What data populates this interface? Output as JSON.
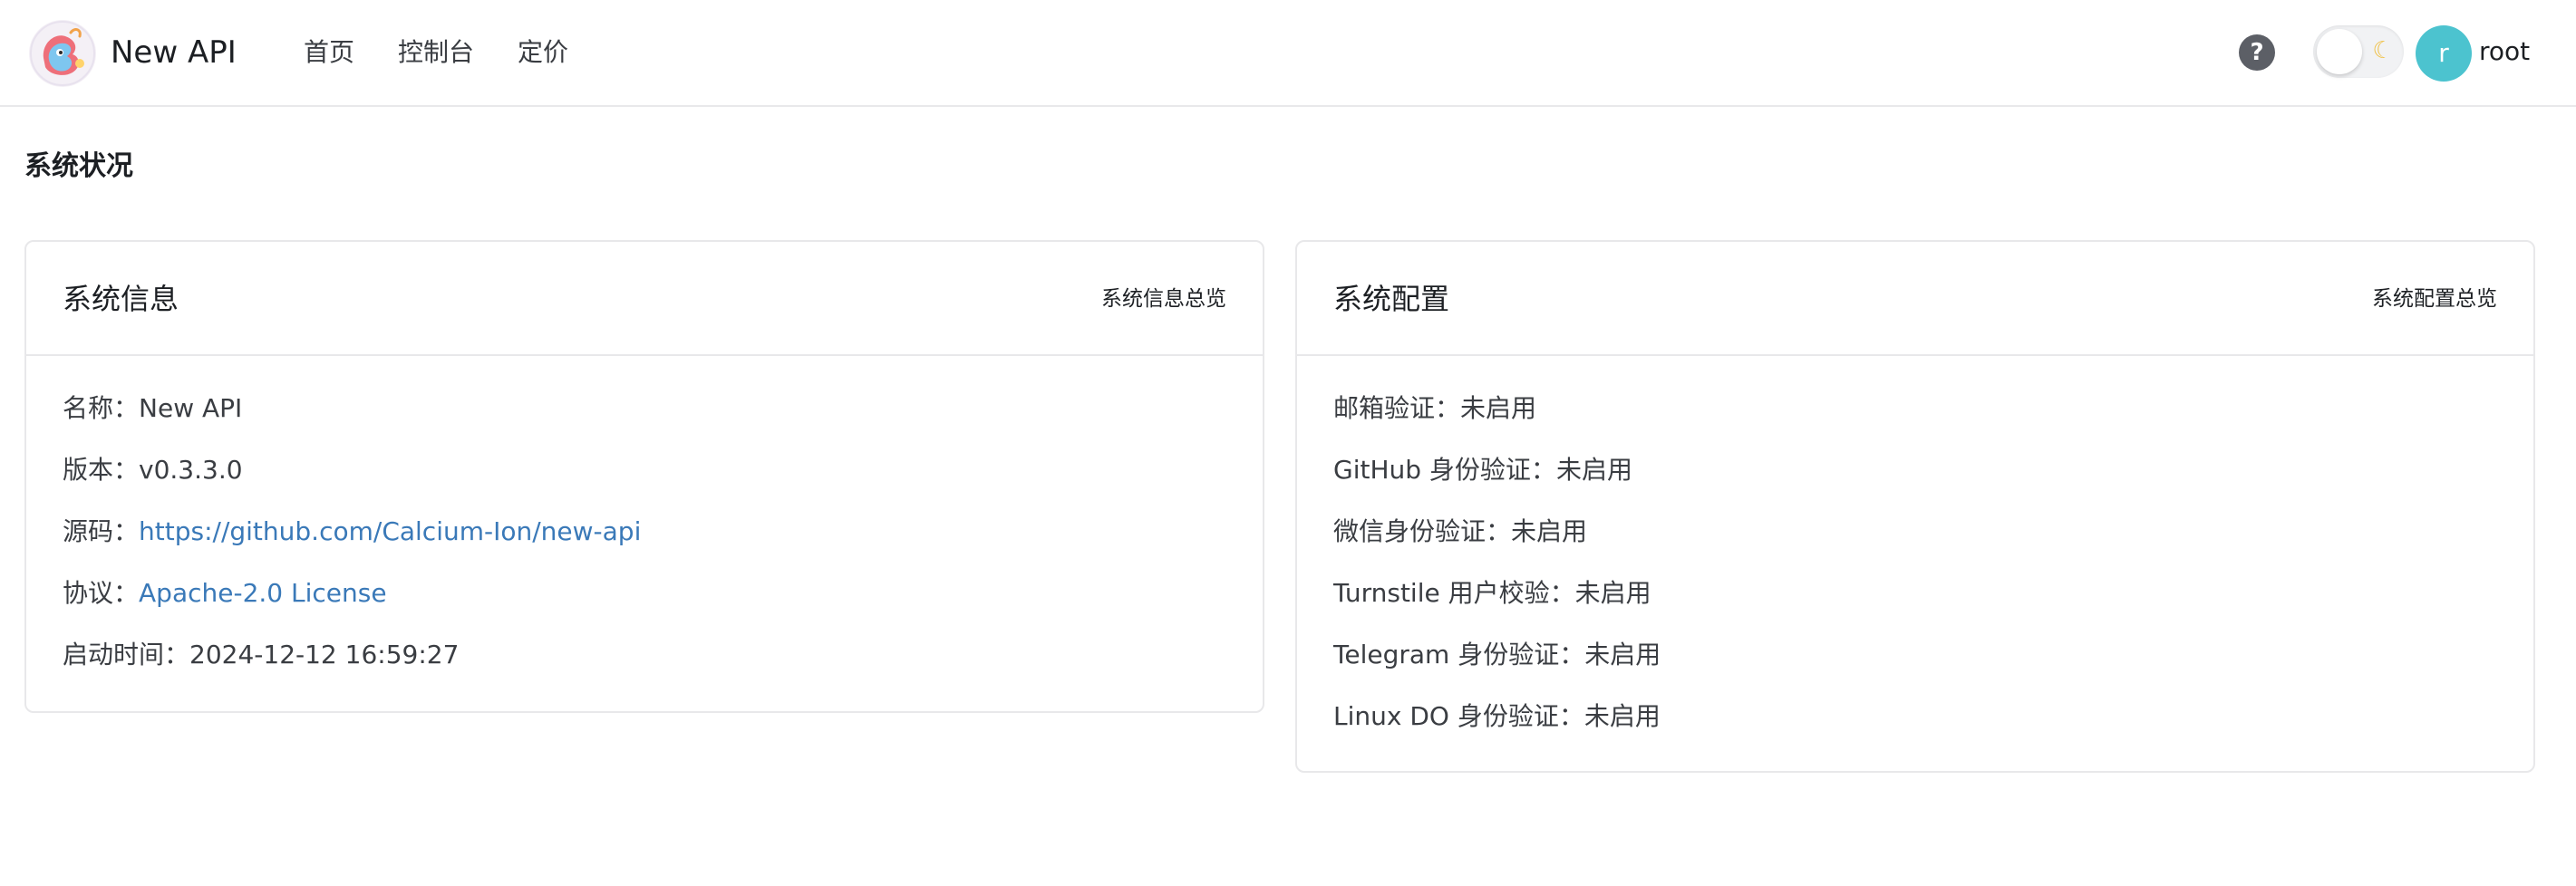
{
  "header": {
    "brand": "New API",
    "nav": [
      "首页",
      "控制台",
      "定价"
    ],
    "help_icon": "question-circle-icon",
    "theme_icon": "moon-icon",
    "avatar_letter": "r",
    "username": "root",
    "colors": {
      "avatar": "#4cc3cf",
      "link": "#3a79b8"
    }
  },
  "page": {
    "title": "系统状况"
  },
  "system_info": {
    "title": "系统信息",
    "extra": "系统信息总览",
    "rows": [
      {
        "label": "名称：",
        "value": "New API"
      },
      {
        "label": "版本：",
        "value": "v0.3.3.0"
      },
      {
        "label": "源码：",
        "value": "https://github.com/Calcium-Ion/new-api"
      },
      {
        "label": "协议：",
        "value": "Apache-2.0 License"
      },
      {
        "label": "启动时间：",
        "value": "2024-12-12 16:59:27"
      }
    ]
  },
  "system_config": {
    "title": "系统配置",
    "extra": "系统配置总览",
    "rows": [
      {
        "label": "邮箱验证：",
        "value": "未启用"
      },
      {
        "label": "GitHub 身份验证：",
        "value": "未启用"
      },
      {
        "label": "微信身份验证：",
        "value": "未启用"
      },
      {
        "label": "Turnstile 用户校验：",
        "value": "未启用"
      },
      {
        "label": "Telegram 身份验证：",
        "value": "未启用"
      },
      {
        "label": "Linux DO 身份验证：",
        "value": "未启用"
      }
    ]
  }
}
